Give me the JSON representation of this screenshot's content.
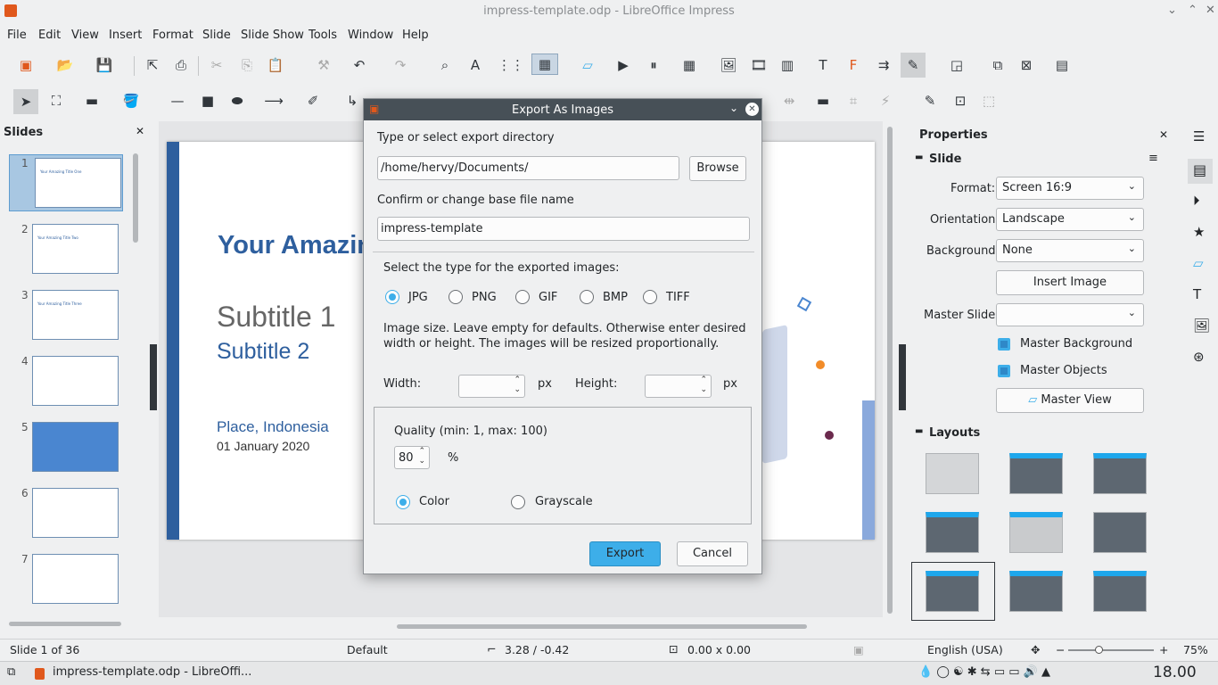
{
  "window": {
    "title": "impress-template.odp - LibreOffice Impress"
  },
  "menu": [
    "File",
    "Edit",
    "View",
    "Insert",
    "Format",
    "Slide",
    "Slide Show",
    "Tools",
    "Window",
    "Help"
  ],
  "slides_panel": {
    "title": "Slides",
    "numbers": [
      "1",
      "2",
      "3",
      "4",
      "5",
      "6",
      "7"
    ],
    "thumb_titles": [
      "Your Amazing Title One",
      "Your Amazing Title Two",
      "Your Amazing Title Three",
      "",
      "",
      "",
      ""
    ]
  },
  "slide": {
    "title": "Your Amazin",
    "subtitle1": "Subtitle 1",
    "subtitle2": "Subtitle 2",
    "place": "Place, Indonesia",
    "date": "01 January 2020"
  },
  "properties": {
    "title": "Properties",
    "section_slide": "Slide",
    "format_label": "Format:",
    "format_value": "Screen 16:9",
    "orientation_label": "Orientation:",
    "orientation_value": "Landscape",
    "background_label": "Background:",
    "background_value": "None",
    "insert_image": "Insert Image",
    "master_slide_label": "Master Slide:",
    "master_slide_value": "",
    "master_background": "Master Background",
    "master_objects": "Master Objects",
    "master_view": "Master View",
    "layouts_title": "Layouts"
  },
  "dialog": {
    "title": "Export As Images",
    "dir_label": "Type or select export directory",
    "dir_value": "/home/hervy/Documents/",
    "browse": "Browse",
    "base_label": "Confirm or change base file name",
    "base_value": "impress-template",
    "type_label": "Select the type for the exported images:",
    "types": [
      "JPG",
      "PNG",
      "GIF",
      "BMP",
      "TIFF"
    ],
    "selected_type": "JPG",
    "size_note": "Image size. Leave empty for defaults. Otherwise enter desired width or height. The images will be resized proportionally.",
    "width_label": "Width:",
    "height_label": "Height:",
    "px": "px",
    "quality_label": "Quality (min: 1, max: 100)",
    "quality_value": "80",
    "percent": "%",
    "color": "Color",
    "grayscale": "Grayscale",
    "selected_mode": "Color",
    "export": "Export",
    "cancel": "Cancel"
  },
  "status": {
    "slide": "Slide 1 of 36",
    "master": "Default",
    "position": "3.28 / -0.42",
    "size": "0.00 x 0.00",
    "language": "English (USA)",
    "zoom": "75%"
  },
  "taskbar": {
    "app": "impress-template.odp - LibreOffi...",
    "clock": "18.00"
  },
  "colors": {
    "accent": "#3daee9",
    "slide_blue": "#2e5f9e",
    "dialog_title": "#475057"
  }
}
